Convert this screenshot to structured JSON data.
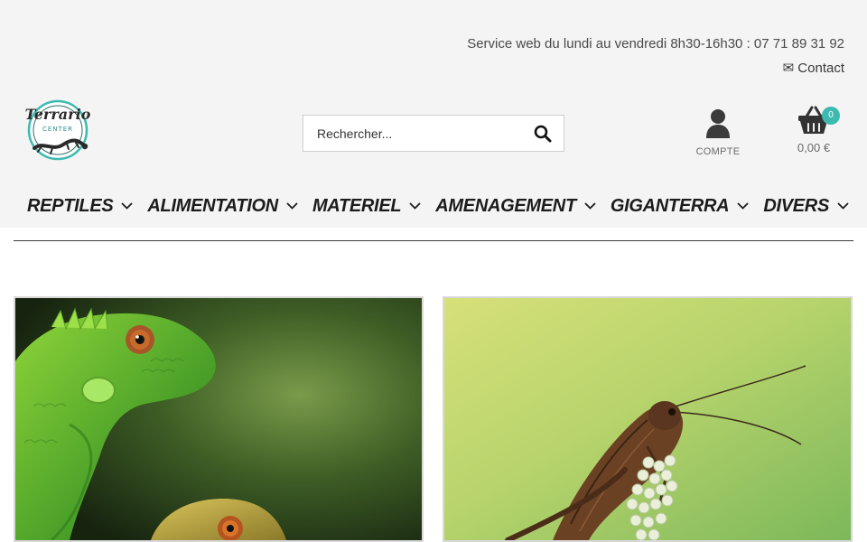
{
  "topbar": {
    "service_text": "Service web du lundi au vendredi 8h30-16h30 : 07 71 89 31 92",
    "contact_label": "✉ Contact"
  },
  "logo": {
    "name": "Terrario",
    "sub": "CENTER"
  },
  "search": {
    "placeholder": "Rechercher..."
  },
  "account": {
    "label": "COMPTE"
  },
  "cart": {
    "count": "0",
    "total": "0,00 €"
  },
  "nav": {
    "items": [
      {
        "label": "REPTILES"
      },
      {
        "label": "ALIMENTATION"
      },
      {
        "label": "MATERIEL"
      },
      {
        "label": "AMENAGEMENT"
      },
      {
        "label": "GIGANTERRA"
      },
      {
        "label": "DIVERS"
      }
    ]
  },
  "colors": {
    "accent": "#3dbab0",
    "text": "#1c1c1c",
    "header_bg": "#f4f4f4"
  },
  "icons": [
    "search-icon",
    "user-icon",
    "basket-icon",
    "chevron-down-icon"
  ]
}
